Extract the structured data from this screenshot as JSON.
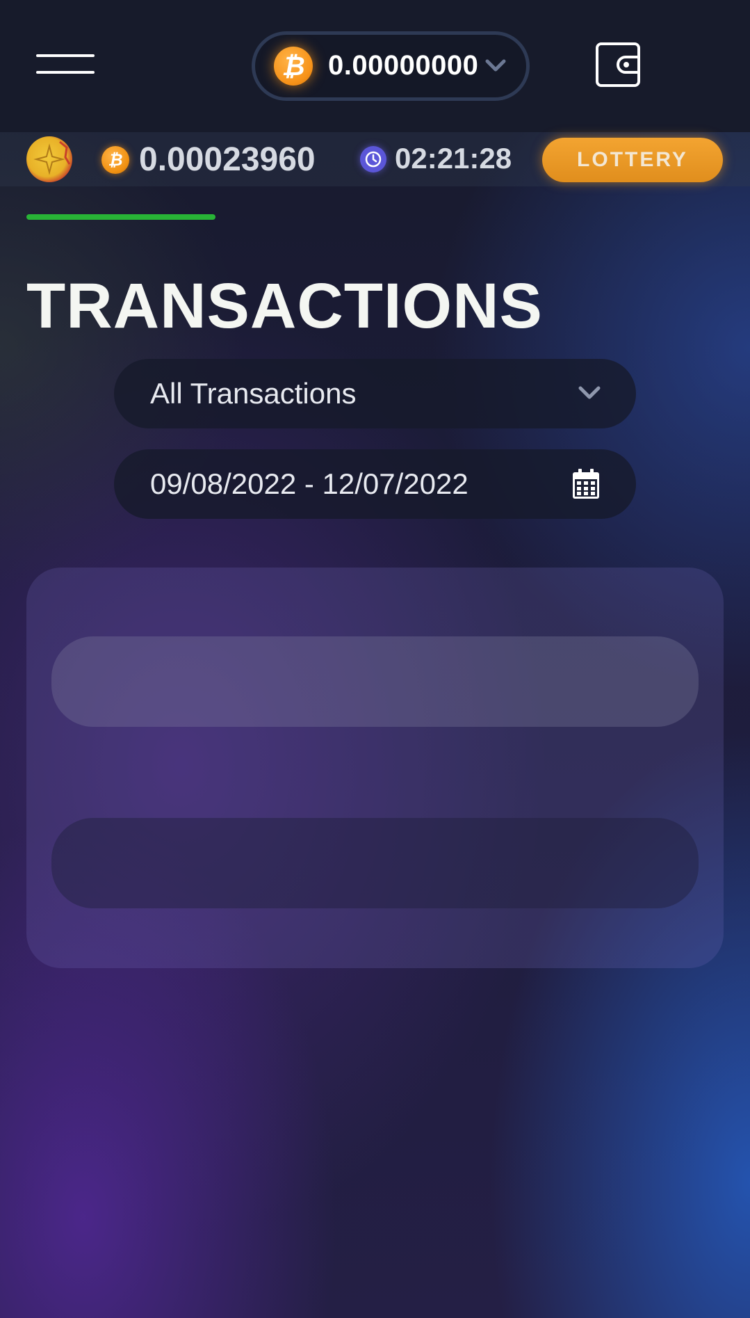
{
  "header": {
    "balance": "0.00000000",
    "currency_icon": "bitcoin-icon"
  },
  "status_bar": {
    "balance": "0.00023960",
    "timer": "02:21:28",
    "lottery_label": "LOTTERY"
  },
  "page": {
    "title": "TRANSACTIONS"
  },
  "filters": {
    "type_value": "All Transactions",
    "date_range": "09/08/2022 - 12/07/2022"
  },
  "icons": {
    "menu": "hamburger-menu-icon",
    "wallet": "wallet-icon",
    "clock": "clock-icon",
    "calendar": "calendar-icon",
    "chevron": "chevron-down-icon"
  },
  "colors": {
    "header_bg": "#171b2b",
    "bitcoin": "#f7931a",
    "lottery": "#e8961f",
    "progress": "#28b436",
    "clock": "#5b56d8"
  }
}
